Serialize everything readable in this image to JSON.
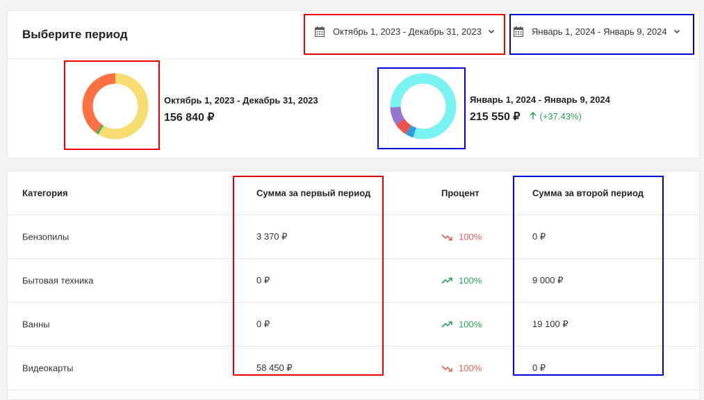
{
  "header": {
    "title": "Выберите период",
    "period1_label": "Октябрь 1, 2023 - Декабрь 31, 2023",
    "period2_label": "Январь 1, 2024 - Январь 9, 2024"
  },
  "summary": {
    "period1": {
      "range": "Октябрь 1, 2023 - Декабрь 31, 2023",
      "total": "156 840 ₽"
    },
    "period2": {
      "range": "Январь 1, 2024 - Январь 9, 2024",
      "total": "215 550 ₽",
      "change": "(+37.43%)"
    }
  },
  "donut1": {
    "segments": [
      {
        "value": 58.7,
        "color": "#f7dc6f"
      },
      {
        "value": 1.2,
        "color": "#3cb371"
      },
      {
        "value": 40.1,
        "color": "#ff7043"
      }
    ]
  },
  "donut2": {
    "segments": [
      {
        "value": 55.0,
        "color": "#79f2f2"
      },
      {
        "value": 4.0,
        "color": "#2f9be0"
      },
      {
        "value": 6.5,
        "color": "#ef5350"
      },
      {
        "value": 9.0,
        "color": "#9575cd"
      },
      {
        "value": 25.5,
        "color": "#79f2f2"
      }
    ]
  },
  "table": {
    "headers": [
      "Категория",
      "Сумма за первый период",
      "Процент",
      "Сумма за второй период"
    ],
    "rows": [
      {
        "category": "Бензопилы",
        "first": "3 370 ₽",
        "percent": "100%",
        "trend": "down",
        "second": "0 ₽"
      },
      {
        "category": "Бытовая техника",
        "first": "0 ₽",
        "percent": "100%",
        "trend": "up",
        "second": "9 000 ₽"
      },
      {
        "category": "Ванны",
        "first": "0 ₽",
        "percent": "100%",
        "trend": "up",
        "second": "19 100 ₽"
      },
      {
        "category": "Видеокарты",
        "first": "58 450 ₽",
        "percent": "100%",
        "trend": "down",
        "second": "0 ₽"
      }
    ]
  },
  "colors": {
    "red_outline": "#e60000",
    "blue_outline": "#0000d9",
    "up": "#2aa05a",
    "down": "#e75a5a"
  }
}
